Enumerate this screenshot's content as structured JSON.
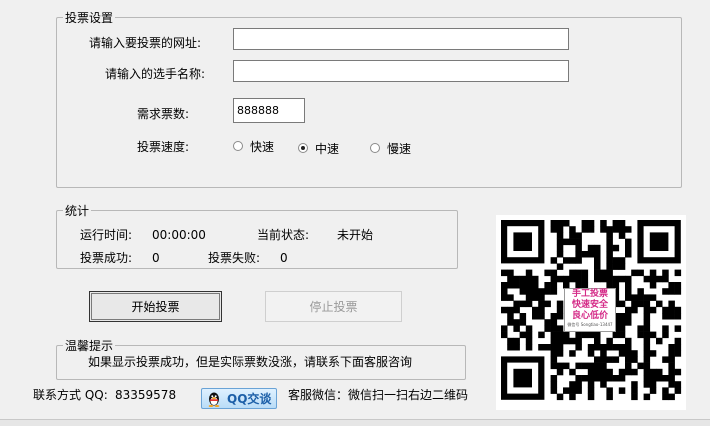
{
  "vote_settings": {
    "title": "投票设置",
    "url_label": "请输入要投票的网址:",
    "url_value": "",
    "name_label": "请输入的选手名称:",
    "name_value": "",
    "count_label": "需求票数:",
    "count_value": "888888",
    "speed_label": "投票速度:",
    "speed_options": [
      "快速",
      "中速",
      "慢速"
    ],
    "speed_selected": "中速"
  },
  "stats": {
    "title": "统计",
    "runtime_label": "运行时间:",
    "runtime_value": "00:00:00",
    "status_label": "当前状态:",
    "status_value": "未开始",
    "success_label": "投票成功:",
    "success_value": "0",
    "fail_label": "投票失败:",
    "fail_value": "0"
  },
  "buttons": {
    "start": "开始投票",
    "stop": "停止投票"
  },
  "tips": {
    "title": "温馨提示",
    "text": "如果显示投票成功，但是实际票数没涨，请联系下面客服咨询"
  },
  "footer": {
    "contact_label": "联系方式 QQ:",
    "qq_number": "83359578",
    "qq_button": "QQ交谈",
    "wechat_text": "客服微信：微信扫一扫右边二维码"
  },
  "qr": {
    "badge_line1": "手工投票",
    "badge_line2": "快速安全",
    "badge_line3": "良心低价",
    "badge_line4": "微信号 Songtiao-13447"
  }
}
